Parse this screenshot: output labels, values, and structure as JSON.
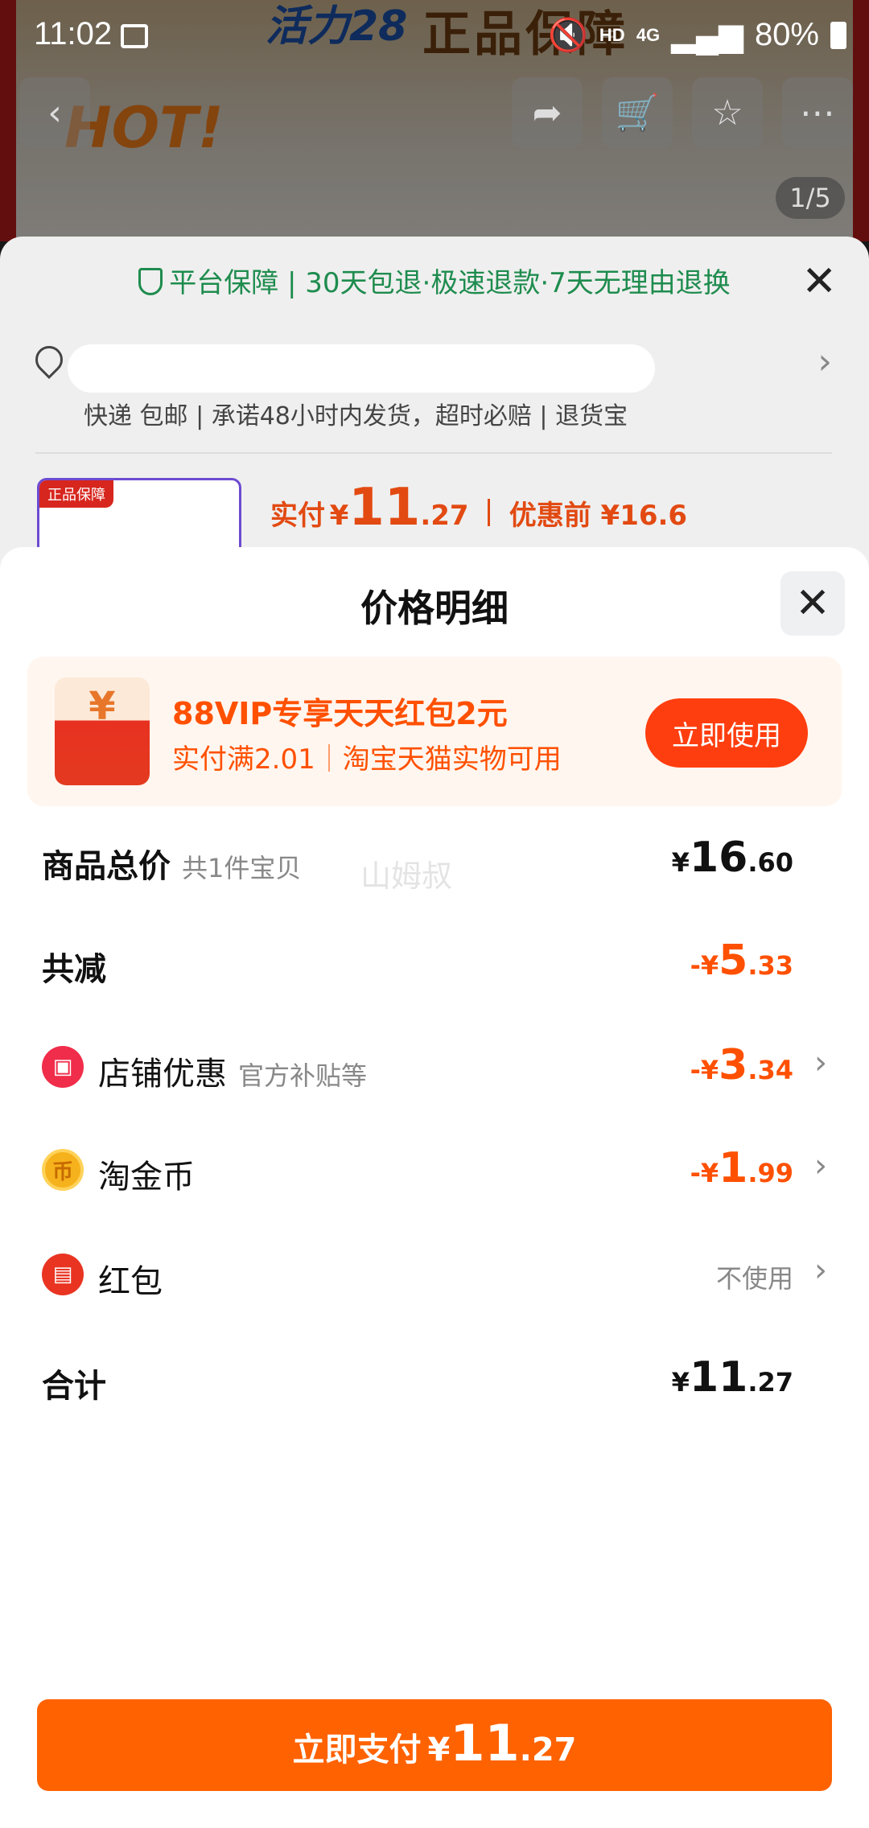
{
  "status_bar": {
    "time": "11:02",
    "network": "4G",
    "hd": "HD",
    "battery": "80%"
  },
  "background": {
    "brand": "活力28",
    "banner": "正品保障",
    "hot": "HOT!",
    "pager": "1/5"
  },
  "sheet": {
    "guarantee": "平台保障 | 30天包退·极速退款·7天无理由退换",
    "shipping": "快递 包邮 | 承诺48小时内发货，超时必赔 | 退货宝",
    "product_tag": "正品保障",
    "pay_label": "实付",
    "pay_currency": "¥",
    "pay_int": "11",
    "pay_dec": ".27",
    "before_label": "优惠前 ¥16.6"
  },
  "price_detail": {
    "title": "价格明细",
    "vip": {
      "title": "88VIP专享天天红包2元",
      "cond1": "实付满2.01",
      "cond2": "淘宝天猫实物可用",
      "button": "立即使用",
      "icon": "¥"
    },
    "total": {
      "label": "商品总价",
      "sub": "共1件宝贝",
      "cur": "¥",
      "int": "16",
      "dec": ".60"
    },
    "reduce": {
      "label": "共减",
      "cur": "-¥",
      "int": "5",
      "dec": ".33"
    },
    "shop": {
      "label": "店铺优惠",
      "sub": "官方补贴等",
      "cur": "-¥",
      "int": "3",
      "dec": ".34"
    },
    "coin": {
      "label": "淘金币",
      "cur": "-¥",
      "int": "1",
      "dec": ".99"
    },
    "redpacket": {
      "label": "红包",
      "value": "不使用"
    },
    "sum": {
      "label": "合计",
      "cur": "¥",
      "int": "11",
      "dec": ".27"
    },
    "watermark": "山姆叔"
  },
  "pay_button": {
    "label": "立即支付",
    "cur": "¥",
    "int": "11",
    "dec": ".27"
  },
  "colors": {
    "accent": "#ff5000",
    "pay_button": "#ff6200",
    "guarantee": "#1e8c4e"
  }
}
